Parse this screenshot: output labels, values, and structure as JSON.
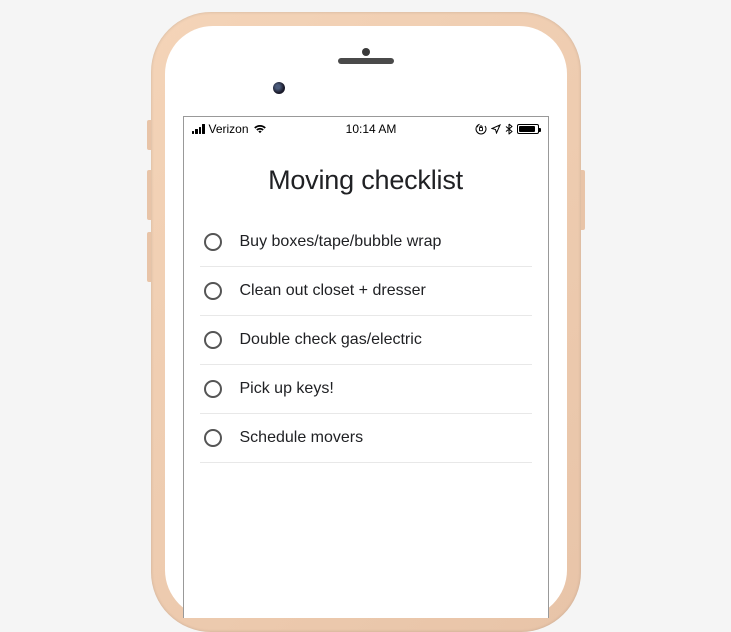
{
  "statusBar": {
    "carrier": "Verizon",
    "time": "10:14 AM"
  },
  "title": "Moving checklist",
  "items": [
    {
      "label": "Buy boxes/tape/bubble wrap"
    },
    {
      "label": "Clean out closet + dresser"
    },
    {
      "label": "Double check gas/electric"
    },
    {
      "label": "Pick up keys!"
    },
    {
      "label": "Schedule movers"
    }
  ]
}
